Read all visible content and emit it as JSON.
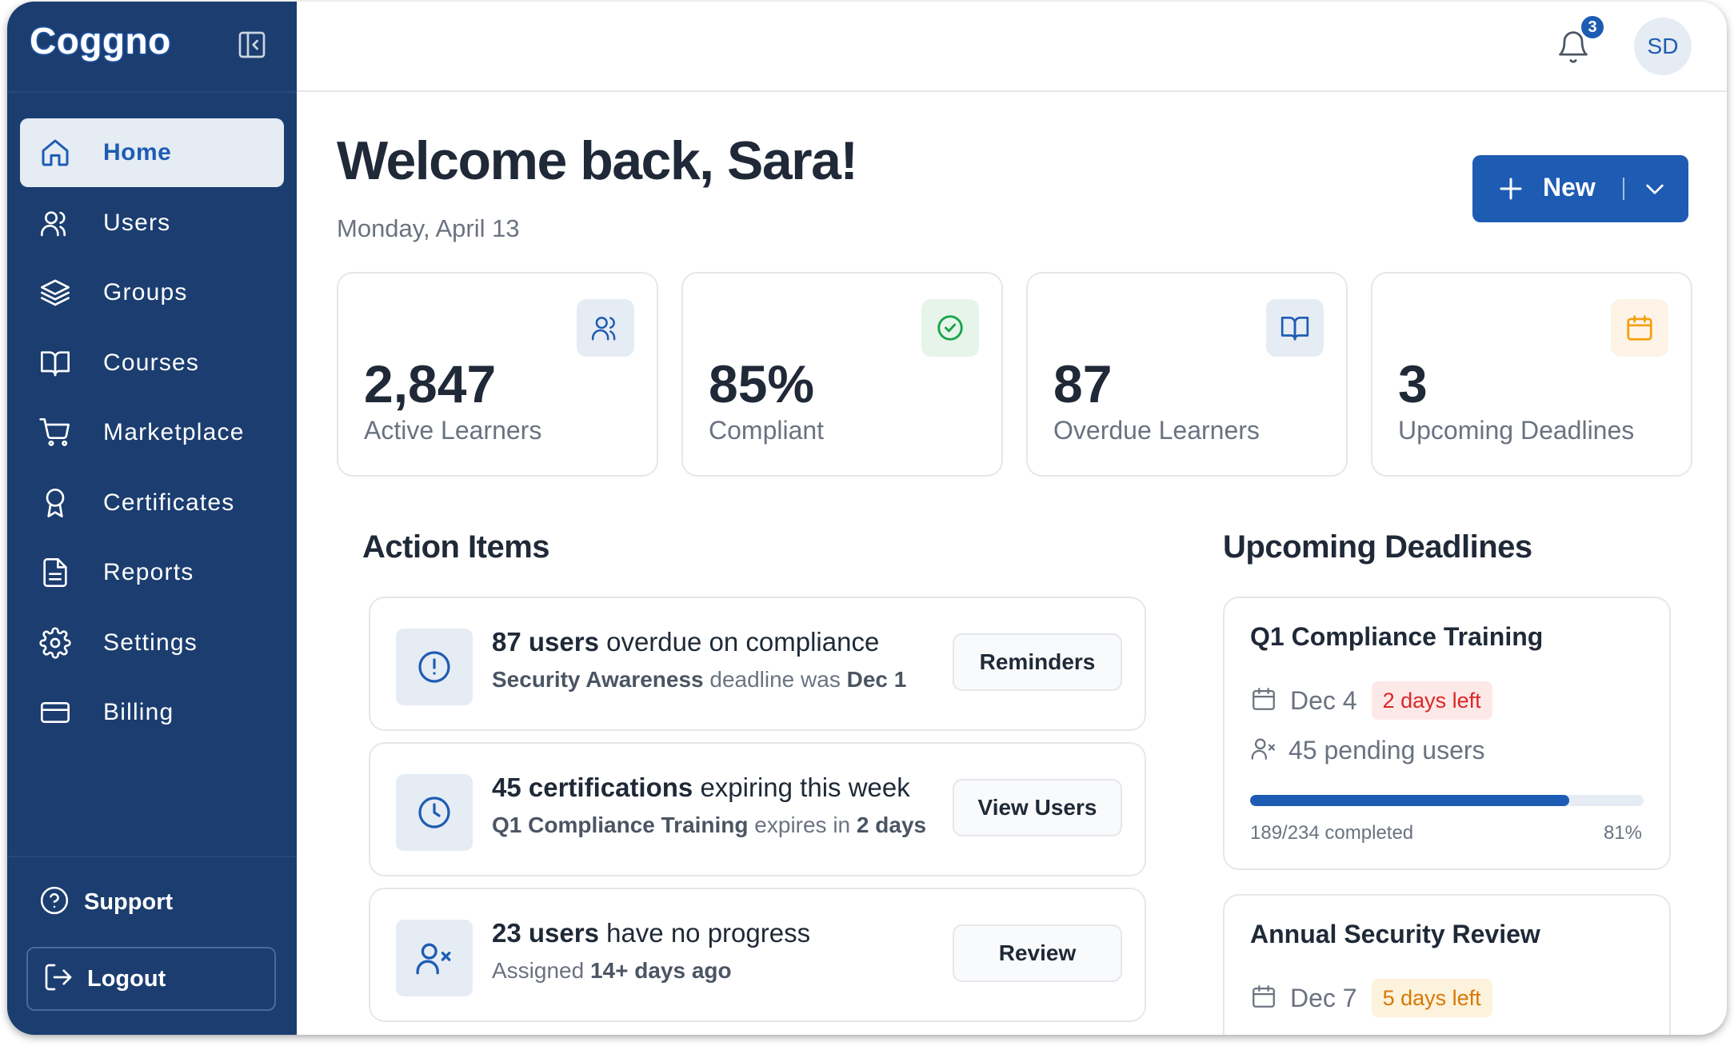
{
  "app": {
    "logo": "Coggno"
  },
  "sidebar": {
    "items": [
      {
        "label": "Home",
        "icon": "home-icon",
        "active": true
      },
      {
        "label": "Users",
        "icon": "users-icon",
        "active": false
      },
      {
        "label": "Groups",
        "icon": "layers-icon",
        "active": false
      },
      {
        "label": "Courses",
        "icon": "book-icon",
        "active": false
      },
      {
        "label": "Marketplace",
        "icon": "cart-icon",
        "active": false
      },
      {
        "label": "Certificates",
        "icon": "award-icon",
        "active": false
      },
      {
        "label": "Reports",
        "icon": "file-text-icon",
        "active": false
      },
      {
        "label": "Settings",
        "icon": "gear-icon",
        "active": false
      },
      {
        "label": "Billing",
        "icon": "credit-card-icon",
        "active": false
      }
    ],
    "support_label": "Support",
    "logout_label": "Logout"
  },
  "topbar": {
    "notification_count": "3",
    "avatar_initials": "SD"
  },
  "header": {
    "greeting": "Welcome back, Sara!",
    "date": "Monday, April 13",
    "new_button_label": "New"
  },
  "stats": [
    {
      "value": "2,847",
      "caption": "Active Learners",
      "icon": "users-icon",
      "accent": "#1e5cb3",
      "tint": "#e6ecf4"
    },
    {
      "value": "85%",
      "caption": "Compliant",
      "icon": "check-circle-icon",
      "accent": "#16a34a",
      "tint": "#e6f4ea"
    },
    {
      "value": "87",
      "caption": "Overdue Learners",
      "icon": "book-icon",
      "accent": "#1e5cb3",
      "tint": "#e6ecf4"
    },
    {
      "value": "3",
      "caption": "Upcoming Deadlines",
      "icon": "calendar-icon",
      "accent": "#f59e0b",
      "tint": "#fdf3e6"
    }
  ],
  "action_items": {
    "title": "Action Items",
    "items": [
      {
        "icon": "alert-circle-icon",
        "headline_bold": "87 users",
        "headline_rest": " overdue on compliance",
        "sub_bold_1": "Security Awareness",
        "sub_text": " deadline was ",
        "sub_bold_2": "Dec 1",
        "button": "Reminders"
      },
      {
        "icon": "clock-icon",
        "headline_bold": "45 certifications",
        "headline_rest": " expiring this week",
        "sub_bold_1": "Q1 Compliance Training",
        "sub_text": " expires in ",
        "sub_bold_2": "2 days",
        "button": "View Users"
      },
      {
        "icon": "user-x-icon",
        "headline_bold": "23 users",
        "headline_rest": " have no progress",
        "sub_bold_1": "",
        "sub_text": "Assigned ",
        "sub_bold_2": "14+ days ago",
        "button": "Review"
      }
    ]
  },
  "upcoming_deadlines": {
    "title": "Upcoming Deadlines",
    "items": [
      {
        "title": "Q1 Compliance Training",
        "date": "Dec 4",
        "days_left": "2 days left",
        "urgency": "red",
        "pending": "45 pending users",
        "progress_text": "189/234 completed",
        "progress_pct": "81%",
        "progress_fraction": 0.81
      },
      {
        "title": "Annual Security Review",
        "date": "Dec 7",
        "days_left": "5 days left",
        "urgency": "amber"
      }
    ]
  }
}
